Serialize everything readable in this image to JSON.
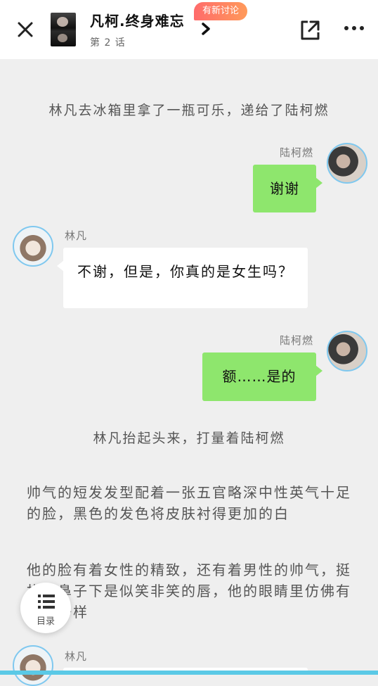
{
  "header": {
    "close_label": "✕",
    "title": "凡柯.终身难忘",
    "chapter": "第 2 话",
    "badge": "有新讨论",
    "more_label": "•••"
  },
  "content": {
    "narration_1": "林凡去冰箱里拿了一瓶可乐，递给了陆柯燃",
    "msg_1": {
      "speaker": "陆柯燃",
      "text": "谢谢"
    },
    "msg_2": {
      "speaker": "林凡",
      "text": "不谢，但是，你真的是女生吗？"
    },
    "msg_3": {
      "speaker": "陆柯燃",
      "text": "额……是的"
    },
    "narration_2": "林凡抬起头来，打量着陆柯燃",
    "para_1": "帅气的短发发型配着一张五官略深中性英气十足的脸，黑色的发色将皮肤衬得更加的白",
    "para_2": "他的脸有着女性的精致，还有着男性的帅气，挺拔的鼻子下是似笑非笑的唇，他的眼睛里仿佛有星星一样",
    "msg_4": {
      "speaker": "林凡"
    }
  },
  "toc": {
    "label": "目录"
  },
  "colors": {
    "accent": "#5bc9e6",
    "bubble_self": "#8ee66d",
    "bubble_other": "#ffffff",
    "badge_start": "#ff6b6b",
    "badge_end": "#ff9a5a"
  }
}
